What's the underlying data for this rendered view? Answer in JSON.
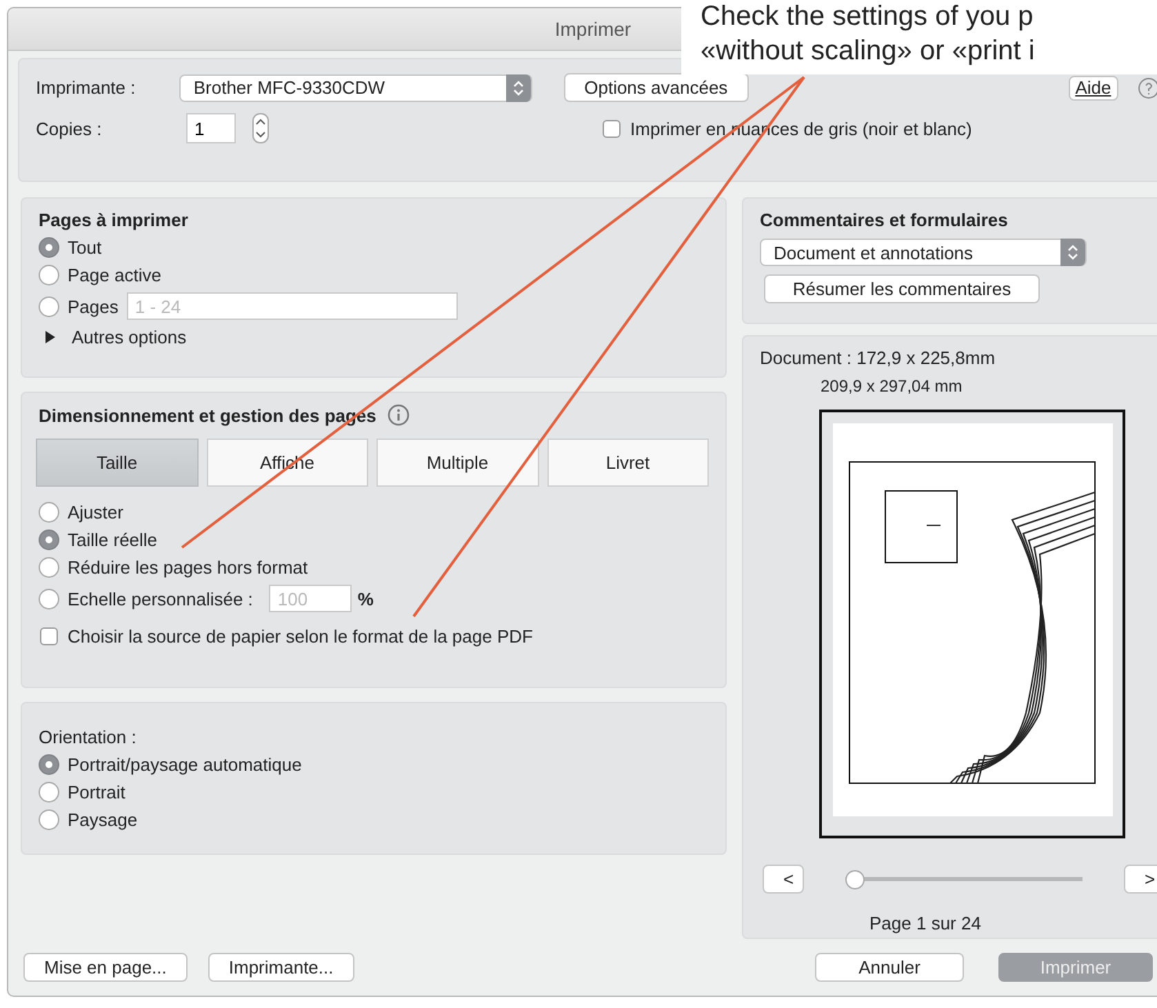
{
  "window": {
    "title": "Imprimer"
  },
  "annotation": {
    "lines": [
      "Check the settings of you p",
      "«without scaling»  or «print i"
    ]
  },
  "printer": {
    "label": "Imprimante :",
    "value": "Brother MFC-9330CDW"
  },
  "advanced_button": "Options avancées",
  "help_button": "Aide",
  "copies": {
    "label": "Copies :",
    "value": "1"
  },
  "grayscale": {
    "label": "Imprimer en nuances de gris (noir et blanc)",
    "checked": false
  },
  "pages_panel": {
    "title": "Pages à imprimer",
    "options": [
      {
        "label": "Tout",
        "selected": true,
        "kind": "plain"
      },
      {
        "label": "Page active",
        "selected": false,
        "kind": "plain"
      },
      {
        "label": "Pages",
        "selected": false,
        "kind": "field",
        "placeholder": "1 - 24"
      }
    ],
    "more_options": {
      "label": "Autres options",
      "expanded": false
    }
  },
  "sizing": {
    "title": "Dimensionnement et gestion des pages",
    "tabs": [
      {
        "label": "Taille",
        "selected": true
      },
      {
        "label": "Affiche",
        "selected": false
      },
      {
        "label": "Multiple",
        "selected": false
      },
      {
        "label": "Livret",
        "selected": false
      }
    ],
    "options": [
      {
        "label": "Ajuster",
        "selected": false,
        "kind": "plain"
      },
      {
        "label": "Taille réelle",
        "selected": true,
        "kind": "plain"
      },
      {
        "label": "Réduire les pages hors format",
        "selected": false,
        "kind": "plain"
      },
      {
        "label": "Echelle personnalisée :",
        "selected": false,
        "kind": "field",
        "placeholder": "100",
        "unit": "%"
      }
    ],
    "paper_source": {
      "label": "Choisir la source de papier selon le format de la page PDF",
      "checked": false
    }
  },
  "orientation": {
    "title": "Orientation :",
    "options": [
      {
        "label": "Portrait/paysage automatique",
        "selected": true
      },
      {
        "label": "Portrait",
        "selected": false
      },
      {
        "label": "Paysage",
        "selected": false
      }
    ]
  },
  "comments": {
    "title": "Commentaires et formulaires",
    "select": "Document et annotations",
    "summary_button": "Résumer les commentaires"
  },
  "preview": {
    "document_size": "Document : 172,9 x 225,8mm",
    "paper_size": "209,9 x 297,04 mm",
    "prev": "<",
    "next": ">",
    "slider": {
      "level": 0
    },
    "page_label": "Page 1 sur 24"
  },
  "footer": {
    "left_buttons": [
      "Mise en page...",
      "Imprimante..."
    ],
    "cancel": "Annuler",
    "print": {
      "label": "Imprimer",
      "disabled": true
    }
  }
}
